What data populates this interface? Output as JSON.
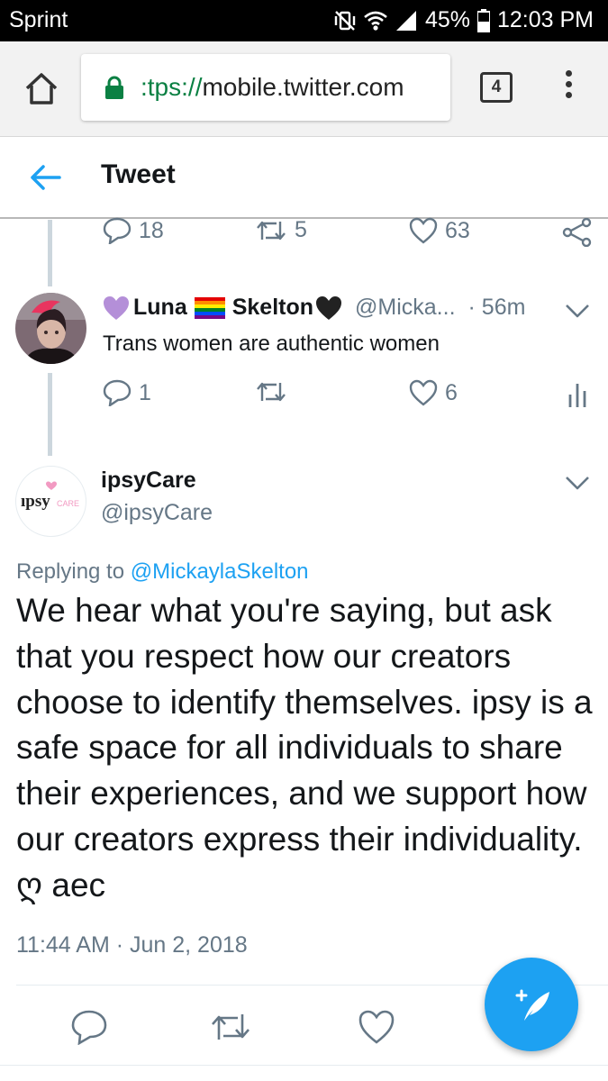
{
  "status_bar": {
    "carrier": "Sprint",
    "battery": "45%",
    "time": "12:03 PM"
  },
  "browser": {
    "url_scheme": ":tps://",
    "url_host": "mobile.twitter.com",
    "tab_count": "4"
  },
  "header": {
    "title": "Tweet"
  },
  "previous_tweet_actions": {
    "replies": "18",
    "retweets": "5",
    "likes": "63"
  },
  "reply_tweet": {
    "name_first": "Luna",
    "name_last": "Skelton",
    "handle": "@Micka...",
    "time": "· 56m",
    "text": "Trans women are authentic women",
    "replies": "1",
    "likes": "6"
  },
  "main_tweet": {
    "name": "ipsyCare",
    "handle": "@ipsyCare",
    "avatar_text": "ıpsy",
    "avatar_sub": "CARE",
    "replying_prefix": "Replying to ",
    "replying_mention": "@MickaylaSkelton",
    "body": "We hear what you're saying, but ask that you respect how our creators choose to identify themselves. ipsy is a safe space for all individuals to share their experiences, and we support how our creators express their individuality. ღ aec",
    "timestamp": "11:44 AM · Jun 2, 2018"
  },
  "colors": {
    "twitter_blue": "#1da1f2",
    "secondary_text": "#657786",
    "primary_text": "#14171a",
    "lock_green": "#0b8043",
    "heart_purple": "#b48fd8",
    "ipsy_pink": "#f29ac2"
  },
  "icons": {
    "home": "home-icon",
    "lock": "lock-icon",
    "tabs": "tabs-icon",
    "menu": "more-vert-icon",
    "back": "arrow-left-icon",
    "reply": "reply-icon",
    "retweet": "retweet-icon",
    "like": "heart-icon",
    "share": "share-icon",
    "analytics": "analytics-icon",
    "compose": "compose-icon"
  }
}
